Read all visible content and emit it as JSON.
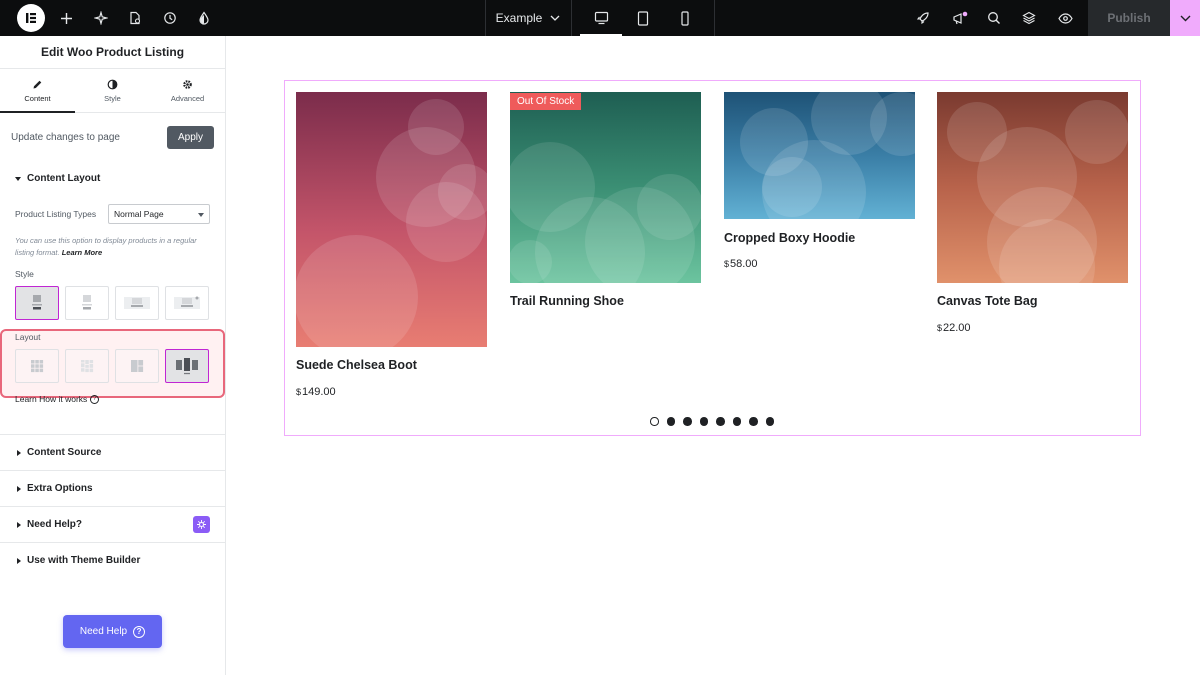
{
  "topbar": {
    "site_name": "Example",
    "publish_label": "Publish",
    "icons": [
      "elementor-logo-icon",
      "plus-icon",
      "sparkle-icon",
      "page-settings-icon",
      "history-icon",
      "theme-drop-icon",
      "desktop-icon",
      "tablet-icon",
      "mobile-icon",
      "rocket-icon",
      "megaphone-icon",
      "search-icon",
      "layers-icon",
      "eye-icon",
      "chevron-down-icon"
    ]
  },
  "panel": {
    "title": "Edit Woo Product Listing",
    "tabs": [
      {
        "label": "Content",
        "icon": "pencil-icon"
      },
      {
        "label": "Style",
        "icon": "half-circle-icon"
      },
      {
        "label": "Advanced",
        "icon": "gear-icon"
      }
    ],
    "update_text": "Update changes to page",
    "apply_label": "Apply",
    "content_layout": {
      "heading": "Content Layout",
      "listing_types_label": "Product Listing Types",
      "listing_types_value": "Normal Page",
      "help_text": "You can use this option to display products in a regular listing format.",
      "help_link": "Learn More",
      "style_label": "Style",
      "layout_label": "Layout",
      "learn_how": "Learn How it works"
    },
    "sections": [
      "Content Source",
      "Extra Options",
      "Need Help?",
      "Use with Theme Builder"
    ],
    "need_help_button": "Need Help"
  },
  "products": [
    {
      "name": "Suede Chelsea Boot",
      "currency": "$",
      "price": "149.00"
    },
    {
      "name": "Trail Running Shoe",
      "currency": "",
      "price": "",
      "badge": "Out Of Stock"
    },
    {
      "name": "Cropped Boxy Hoodie",
      "currency": "$",
      "price": "58.00"
    },
    {
      "name": "Canvas Tote Bag",
      "currency": "$",
      "price": "22.00"
    }
  ],
  "carousel": {
    "dot_count": 8,
    "active_index": 0
  },
  "colors": {
    "accent": "#c026d3",
    "highlight_border": "#e8677b",
    "badge_red": "#ef5b5b",
    "help_button": "#6366f1"
  }
}
